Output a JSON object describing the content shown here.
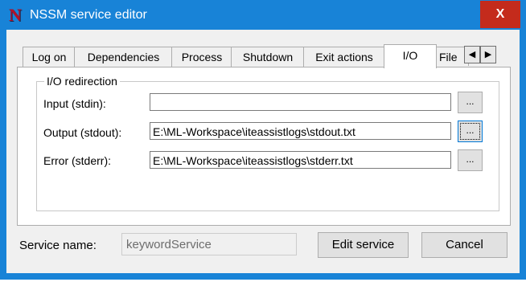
{
  "window": {
    "title": "NSSM service editor",
    "app_icon_letter": "N",
    "close_glyph": "X",
    "icon_name": "nssm-app-icon"
  },
  "tabs": [
    {
      "label": "Log on",
      "active": false
    },
    {
      "label": "Dependencies",
      "active": false
    },
    {
      "label": "Process",
      "active": false
    },
    {
      "label": "Shutdown",
      "active": false
    },
    {
      "label": "Exit actions",
      "active": false
    },
    {
      "label": "I/O",
      "active": true
    },
    {
      "label": "File",
      "active": false
    }
  ],
  "tab_scroll": {
    "left_glyph": "◀",
    "right_glyph": "▶"
  },
  "io_group": {
    "title": "I/O redirection",
    "fields": [
      {
        "label": "Input (stdin):",
        "value": "",
        "browse_label": "..."
      },
      {
        "label": "Output (stdout):",
        "value": "E:\\ML-Workspace\\iteassistlogs\\stdout.txt",
        "browse_label": "..."
      },
      {
        "label": "Error (stderr):",
        "value": "E:\\ML-Workspace\\iteassistlogs\\stderr.txt",
        "browse_label": "..."
      }
    ]
  },
  "footer": {
    "service_name_label": "Service name:",
    "service_name_value": "keywordService",
    "edit_button": "Edit service",
    "cancel_button": "Cancel"
  },
  "colors": {
    "titlebar": "#1883d7",
    "close_button": "#c42b1c",
    "dialog_bg": "#f0f0f0"
  }
}
